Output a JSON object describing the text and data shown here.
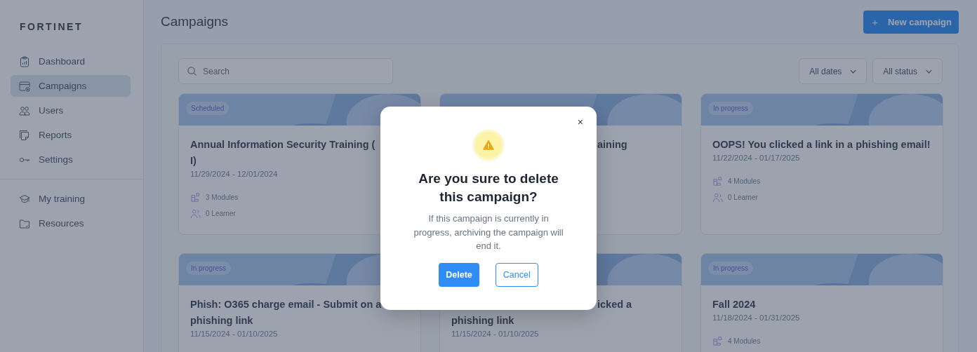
{
  "logo": "FORTINET",
  "nav": [
    {
      "label": "Dashboard",
      "selected": false
    },
    {
      "label": "Campaigns",
      "selected": true
    },
    {
      "label": "Users",
      "selected": false
    },
    {
      "label": "Reports",
      "selected": false
    },
    {
      "label": "Settings",
      "selected": false
    }
  ],
  "nav_secondary": [
    {
      "label": "My training",
      "selected": false
    },
    {
      "label": "Resources",
      "selected": false
    }
  ],
  "page_title": "Campaigns",
  "new_button": {
    "icon": "+",
    "label": "New campaign"
  },
  "search": {
    "placeholder": "Search"
  },
  "filters": [
    "All dates",
    "All status"
  ],
  "cards": [
    {
      "badge": "Scheduled",
      "title_lines": [
        "Annual Information Security Training (",
        "I)"
      ],
      "dates": "11/29/2024 - 12/01/2024",
      "modules": "3 Modules",
      "learners": "0 Learner"
    },
    {
      "title_tail": "aining"
    },
    {
      "badge": "In progress",
      "title_lines": [
        "OOPS! You clicked a link in a phishing email!"
      ],
      "dates": "11/22/2024 - 01/17/2025",
      "modules": "4 Modules",
      "learners": "0 Learner"
    },
    {
      "badge": "In progress",
      "title_lines": [
        "Phish: O365 charge email - Submit on a",
        "phishing link"
      ],
      "dates": "11/15/2024 - 01/10/2025"
    },
    {
      "title_tail": "icked a",
      "title_lines": [
        "phishing link"
      ],
      "dates": "11/15/2024 - 01/10/2025"
    },
    {
      "badge": "In progress",
      "title_lines": [
        "Fall 2024"
      ],
      "dates": "11/18/2024 - 01/31/2025",
      "modules": "4 Modules"
    }
  ],
  "dialog": {
    "close": "×",
    "title": "Are you sure to delete this campaign?",
    "message": "If this campaign is currently in progress, archiving the campaign will end it.",
    "confirm": "Delete",
    "cancel": "Cancel"
  }
}
